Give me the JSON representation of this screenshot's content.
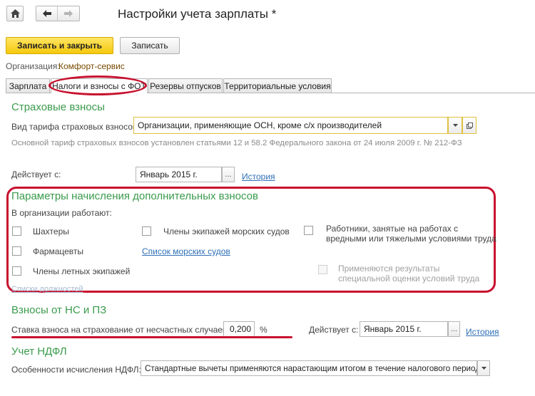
{
  "window": {
    "title": "Настройки учета зарплаты *",
    "nav": {
      "home_icon": "home-icon",
      "back_icon": "arrow-left-icon",
      "forward_icon": "arrow-right-icon"
    }
  },
  "toolbar": {
    "save_close_label": "Записать и закрыть",
    "save_label": "Записать"
  },
  "organization": {
    "label": "Организация:",
    "value": "Комфорт-сервис"
  },
  "tabs": [
    {
      "label": "Зарплата"
    },
    {
      "label": "Налоги и взносы с ФОТ"
    },
    {
      "label": "Резервы отпусков"
    },
    {
      "label": "Территориальные условия"
    }
  ],
  "insurance": {
    "title": "Страховые взносы",
    "tariff_label": "Вид тарифа страховых взносов:",
    "tariff_value": "Организации, применяющие ОСН, кроме с/х производителей",
    "tariff_note": "Основной тариф страховых взносов установлен статьями 12 и 58.2 Федерального закона от 24 июля 2009 г. № 212-ФЗ",
    "effective_label": "Действует с:",
    "effective_value": "Январь 2015 г.",
    "history_link": "История"
  },
  "additional": {
    "title": "Параметры начисления дополнительных взносов",
    "subtitle": "В организации работают:",
    "miners": "Шахтеры",
    "sea_crew": "Члены экипажей морских судов",
    "hazardous": [
      "Работники, занятые на работах с",
      "вредными или тяжелыми условиями труда"
    ],
    "pharmacists": "Фармацевты",
    "sea_ships_link": "Список морских судов",
    "flight_crew": "Члены летных экипажей",
    "assessment": [
      "Применяются результаты",
      "специальной оценки условий труда"
    ],
    "positions_link": "Списки должностей"
  },
  "accident": {
    "title": "Взносы от НС и ПЗ",
    "rate_label": "Ставка взноса на страхование от несчастных случаев:",
    "rate_value": "0,200",
    "rate_unit": "%",
    "effective_label": "Действует с:",
    "effective_value": "Январь 2015 г.",
    "history_link": "История"
  },
  "ndfl": {
    "title": "Учет НДФЛ",
    "calc_label": "Особенности исчисления НДФЛ:",
    "calc_value": "Стандартные вычеты применяются нарастающим итогом в течение налогового периода"
  },
  "colors": {
    "accent_green": "#3a9b4c",
    "highlight_red": "#c8102e",
    "primary_yellow": "#f5c90d",
    "link_blue": "#2f6fb5"
  }
}
